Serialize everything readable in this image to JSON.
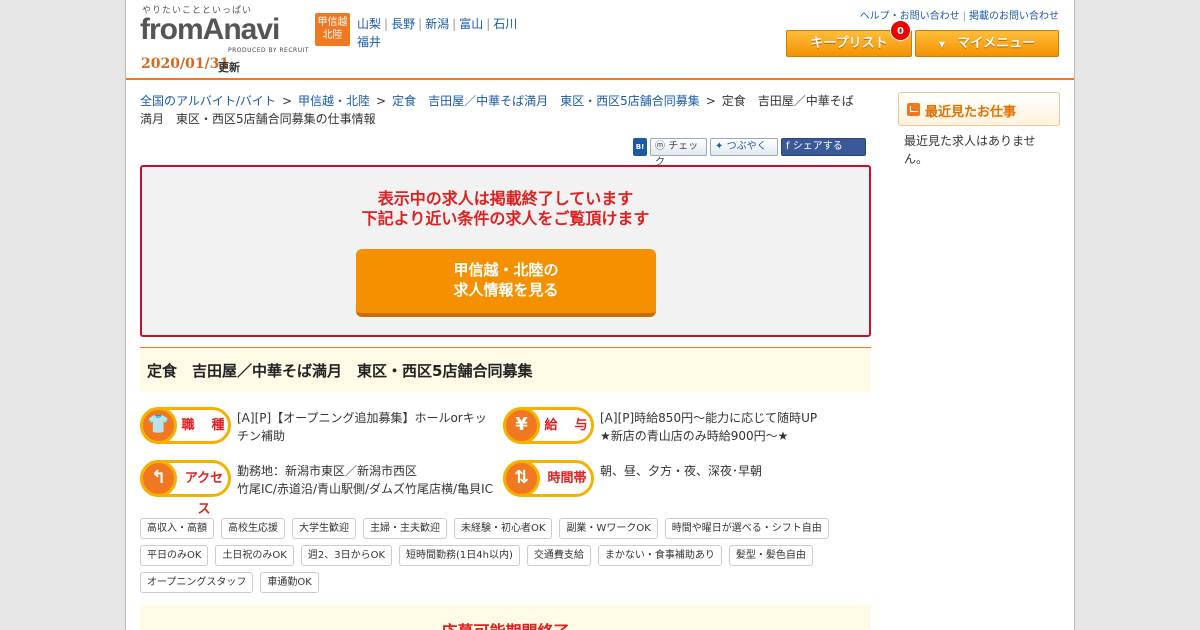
{
  "header": {
    "tagline": "やりたいことといっぱい",
    "logo_text": "fromAnavi",
    "logo_sub": "PRODUCED BY RECRUIT",
    "update_date": "2020/01/31",
    "update_label": "更新",
    "region_badge": [
      "甲信越",
      "北陸"
    ],
    "region_links": [
      "山梨",
      "長野",
      "新潟",
      "富山",
      "石川",
      "福井"
    ],
    "help_links": [
      "ヘルプ・お問い合わせ",
      "掲載のお問い合わせ"
    ],
    "keeplist_label": "キープリスト",
    "keeplist_count": "0",
    "mymenu_label": "マイメニュー"
  },
  "breadcrumb": {
    "items": [
      "全国のアルバイト/バイト",
      "甲信越・北陸",
      "定食　吉田屋／中華そば満月　東区・西区5店舗合同募集"
    ],
    "current": "定食　吉田屋／中華そば満月　東区・西区5店舗合同募集の仕事情報"
  },
  "social": {
    "hb": "B!",
    "mixi": "チェック",
    "twitter": "つぶやく",
    "facebook": "シェアする"
  },
  "ended": {
    "line1": "表示中の求人は掲載終了しています",
    "line2": "下記より近い条件の求人をご覧頂けます",
    "button_line1": "甲信越・北陸の",
    "button_line2": "求人情報を見る"
  },
  "job": {
    "title": "定食　吉田屋／中華そば満月　東区・西区5店舗合同募集",
    "type_label": "職　種",
    "type_text": "[A][P]【オープニング追加募集】ホールorキッチン補助",
    "pay_label": "給　与",
    "pay_line1": "[A][P]時給850円～能力に応じて随時UP",
    "pay_line2": "★新店の青山店のみ時給900円～★",
    "access_label": "アクセス",
    "access_line1": "勤務地：新潟市東区／新潟市西区",
    "access_line2": "竹尾IC/赤道沿/青山駅側/ダムズ竹尾店横/亀貝IC",
    "time_label": "時間帯",
    "time_text": "朝、昼、夕方・夜、深夜･早朝"
  },
  "tags": [
    "高収入・高額",
    "高校生応援",
    "大学生歓迎",
    "主婦・主夫歓迎",
    "未経験・初心者OK",
    "副業・WワークOK",
    "時間や曜日が選べる・シフト自由",
    "平日のみOK",
    "土日祝のみOK",
    "週2、3日からOK",
    "短時間勤務(1日4h以内)",
    "交通費支給",
    "まかない・食事補助あり",
    "髪型・髪色自由",
    "オープニングスタッフ",
    "車通勤OK"
  ],
  "apply_ended": "応募可能期間終了",
  "sidebar": {
    "recent_title": "最近見たお仕事",
    "recent_empty": "最近見た求人はありません。"
  },
  "colors": {
    "accent": "#f07820",
    "alert": "#e02020",
    "link": "#1a5aa6"
  }
}
